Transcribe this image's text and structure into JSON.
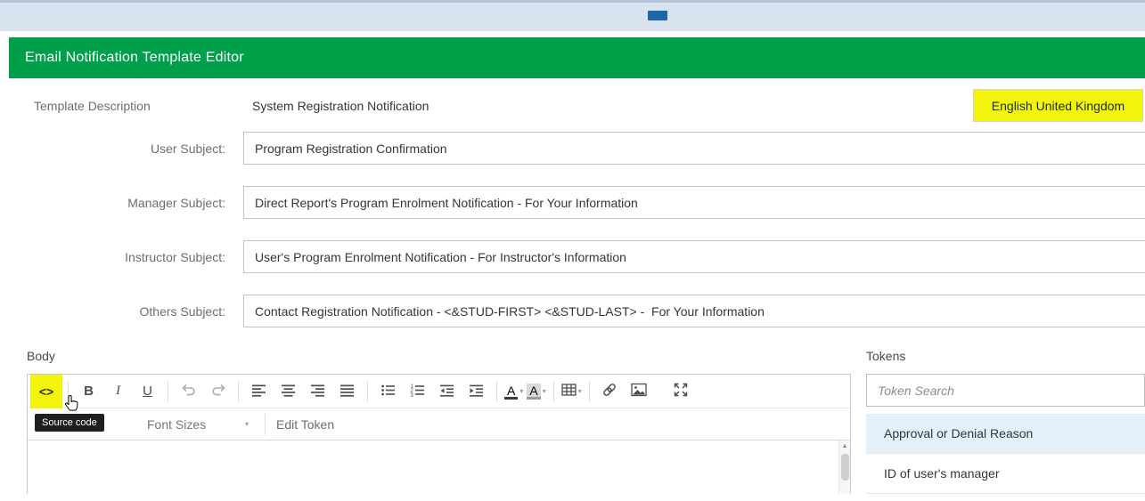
{
  "colors": {
    "header_green": "#00A04A",
    "highlight_yellow": "#F2F40C",
    "token_selected_bg": "#E3F0F9",
    "tooltip_bg": "#1F1F1F"
  },
  "header": {
    "title": "Email Notification Template Editor"
  },
  "template": {
    "description_label": "Template Description",
    "description_value": "System Registration Notification",
    "language_button": "English United Kingdom"
  },
  "fields": [
    {
      "label": "User Subject:",
      "value": "Program Registration Confirmation"
    },
    {
      "label": "Manager Subject:",
      "value": "Direct Report's Program Enrolment Notification - For Your Information"
    },
    {
      "label": "Instructor Subject:",
      "value": "User's Program Enrolment Notification - For Instructor's Information"
    },
    {
      "label": "Others Subject:",
      "value": "Contact Registration Notification - <&STUD-FIRST> <&STUD-LAST> -  For Your Information"
    }
  ],
  "editor": {
    "label": "Body",
    "tooltip": "Source code",
    "font_sizes_label": "Font Sizes",
    "edit_token_label": "Edit Token"
  },
  "icons": {
    "source_code": "<>",
    "bold": "B",
    "italic": "I",
    "underline": "U",
    "text_color": "A",
    "background_color": "A",
    "dropdown_caret": "▾",
    "scroll_up": "▲"
  },
  "tokens": {
    "title": "Tokens",
    "search_placeholder": "Token Search",
    "items": [
      {
        "label": "Approval or Denial Reason",
        "selected": true
      },
      {
        "label": "ID of user's manager",
        "selected": false
      }
    ]
  }
}
